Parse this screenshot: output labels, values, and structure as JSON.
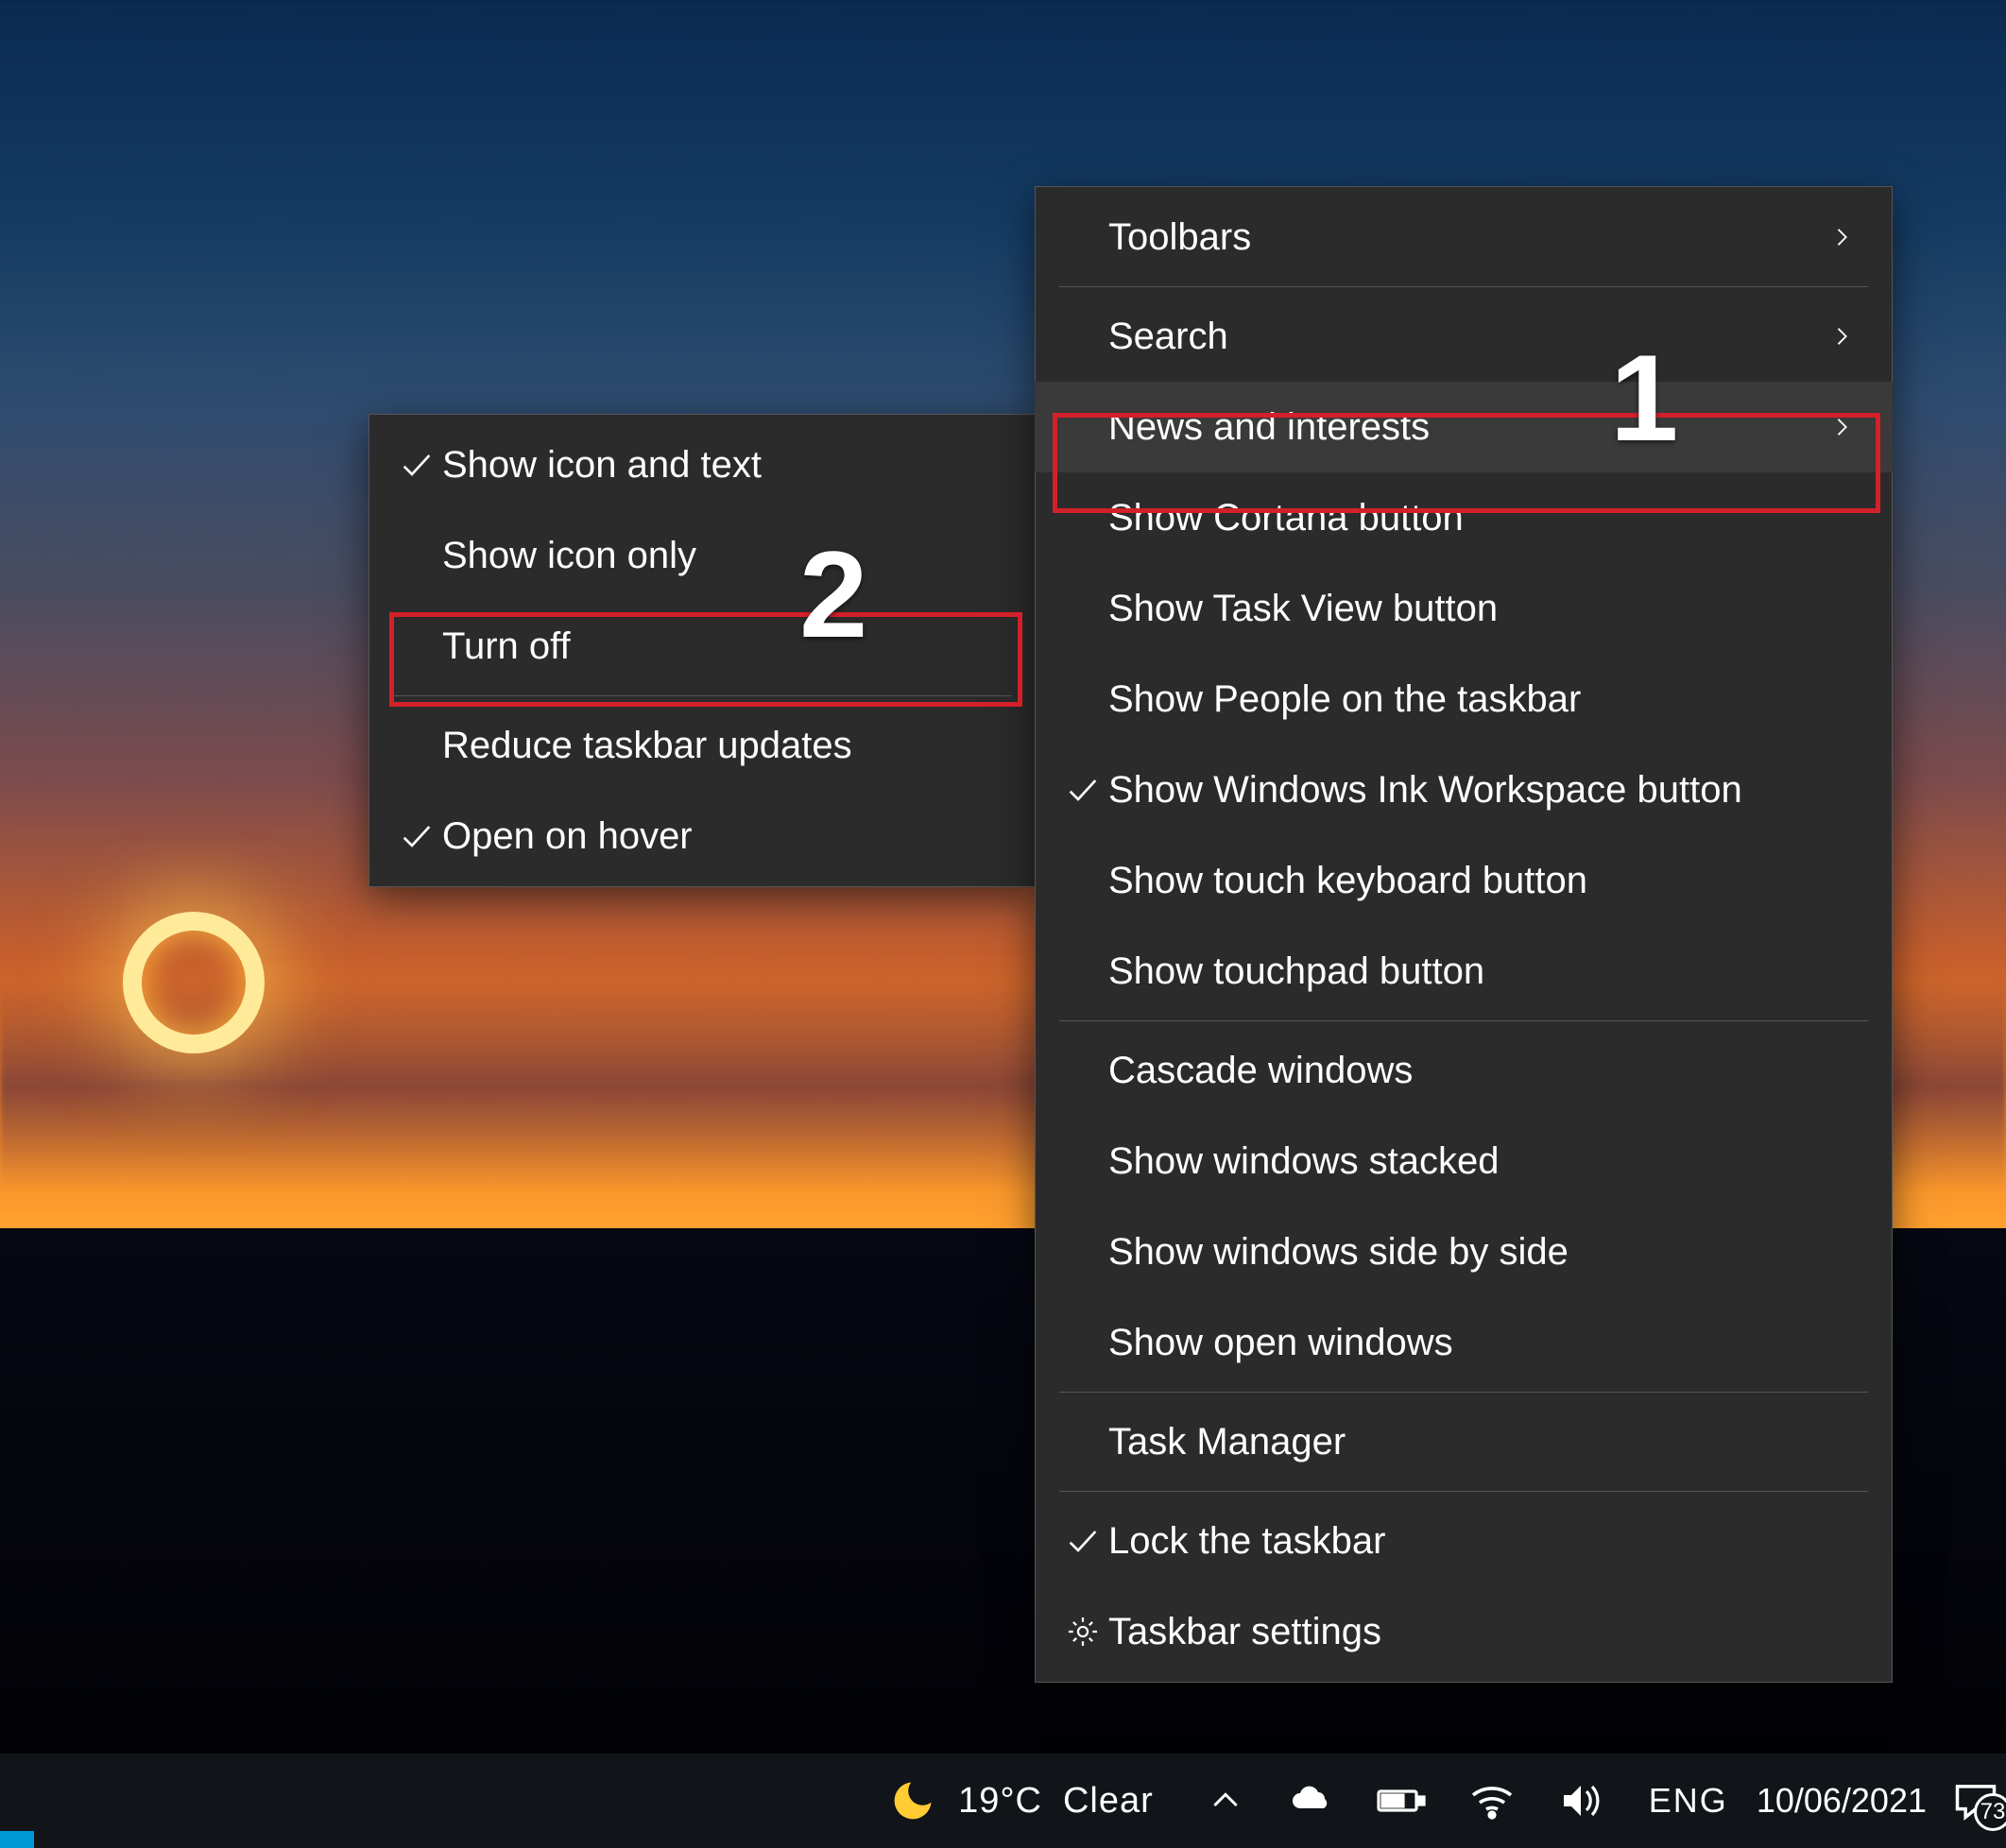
{
  "annotations": {
    "n1": "1",
    "n2": "2"
  },
  "taskbar": {
    "weather": {
      "temp": "19°C",
      "condition": "Clear"
    },
    "language": "ENG",
    "date": "10/06/2021",
    "notification_count": "73"
  },
  "main_menu": {
    "toolbars": "Toolbars",
    "search": "Search",
    "news": "News and interests",
    "cortana": "Show Cortana button",
    "task_view": "Show Task View button",
    "people": "Show People on the taskbar",
    "ink": "Show Windows Ink Workspace button",
    "touch_kbd": "Show touch keyboard button",
    "touchpad": "Show touchpad button",
    "cascade": "Cascade windows",
    "stacked": "Show windows stacked",
    "sidebyside": "Show windows side by side",
    "show_open": "Show open windows",
    "taskmgr": "Task Manager",
    "lock": "Lock the taskbar",
    "settings": "Taskbar settings"
  },
  "sub_menu": {
    "icon_text": "Show icon and text",
    "icon_only": "Show icon only",
    "turn_off": "Turn off",
    "reduce": "Reduce taskbar updates",
    "open_hover": "Open on hover"
  }
}
